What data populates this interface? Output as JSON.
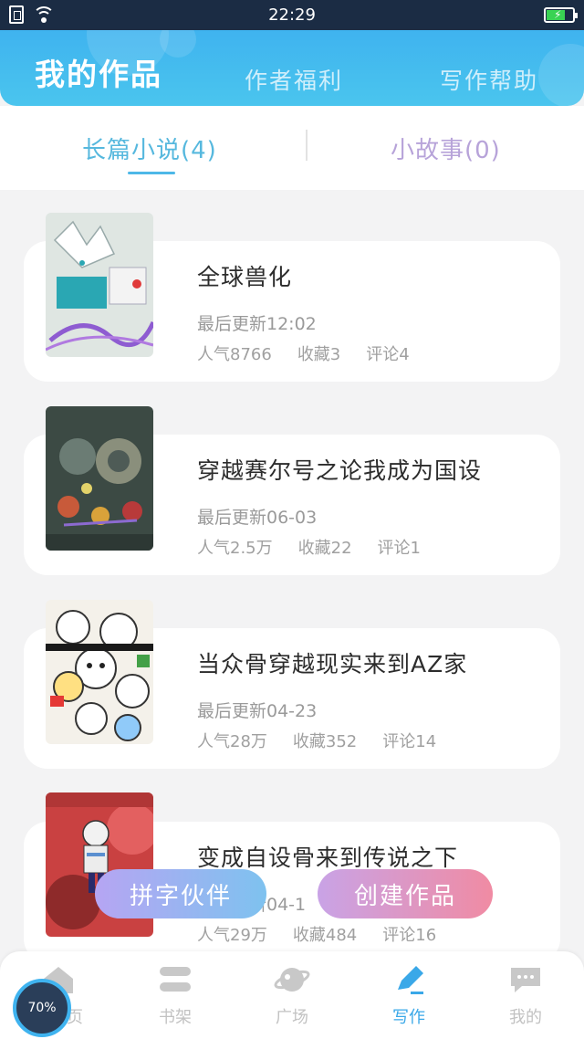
{
  "status_bar": {
    "time": "22:29"
  },
  "header": {
    "tabs": [
      {
        "label": "我的作品",
        "active": true
      },
      {
        "label": "作者福利",
        "active": false
      },
      {
        "label": "写作帮助",
        "active": false
      }
    ]
  },
  "subtabs": {
    "long": "长篇小说(4)",
    "short": "小故事(0)"
  },
  "works": [
    {
      "title": "全球兽化",
      "update": "最后更新12:02",
      "popularity": "人气8766",
      "favorites": "收藏3",
      "comments": "评论4"
    },
    {
      "title": "穿越赛尔号之论我成为国设",
      "update": "最后更新06-03",
      "popularity": "人气2.5万",
      "favorites": "收藏22",
      "comments": "评论1"
    },
    {
      "title": "当众骨穿越现实来到AZ家",
      "update": "最后更新04-23",
      "popularity": "人气28万",
      "favorites": "收藏352",
      "comments": "评论14"
    },
    {
      "title": "变成自设骨来到传说之下",
      "update": "最后更新04-1",
      "popularity": "人气29万",
      "favorites": "收藏484",
      "comments": "评论16"
    }
  ],
  "fab": {
    "partner": "拼字伙伴",
    "create": "创建作品"
  },
  "bottom_nav": [
    {
      "label": "页",
      "icon": "home-icon"
    },
    {
      "label": "书架",
      "icon": "bookshelf-icon"
    },
    {
      "label": "广场",
      "icon": "planet-icon"
    },
    {
      "label": "写作",
      "icon": "pen-icon",
      "active": true
    },
    {
      "label": "我的",
      "icon": "chat-bubble-icon"
    }
  ],
  "progress_widget": {
    "percent": "70%"
  },
  "colors": {
    "accent": "#3fb3ef",
    "subtab_active": "#56b8de",
    "subtab_inactive": "#b7a3d9"
  }
}
